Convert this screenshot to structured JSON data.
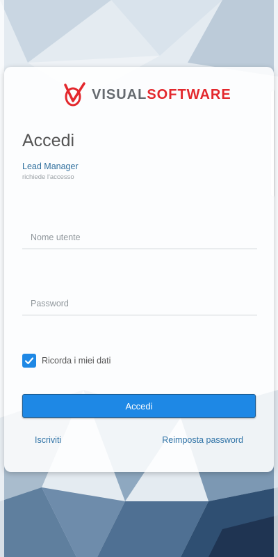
{
  "colors": {
    "accent": "#1e88e5",
    "brand_red": "#e3282d",
    "brand_gray": "#666b70",
    "link": "#2e72a6"
  },
  "logo": {
    "icon": "visual-software-logo-icon",
    "word1": "VISUAL",
    "word2": "SOFTWARE"
  },
  "login": {
    "title": "Accedi",
    "app_name": "Lead Manager",
    "app_subtitle": "richiede l'accesso",
    "username": {
      "placeholder": "Nome utente",
      "value": ""
    },
    "password": {
      "placeholder": "Password",
      "value": ""
    },
    "remember": {
      "label": "Ricorda i miei dati",
      "checked": true,
      "icon": "check-icon"
    },
    "submit_label": "Accedi",
    "register_label": "Iscriviti",
    "reset_label": "Reimposta password"
  }
}
